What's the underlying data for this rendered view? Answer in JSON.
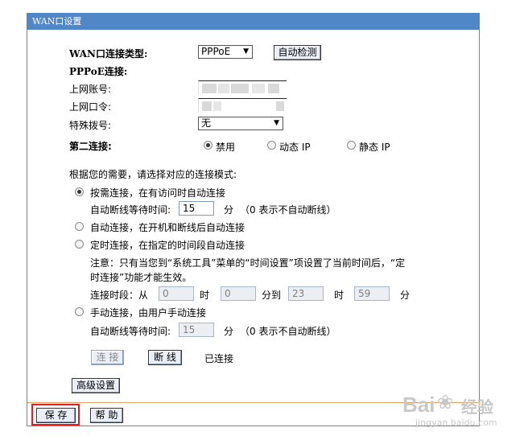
{
  "panel": {
    "title": "WAN口设置"
  },
  "wan_type": {
    "label": "WAN口连接类型:",
    "value": "PPPoE",
    "detect_button": "自动检测"
  },
  "pppoe": {
    "section_label": "PPPoE连接:",
    "username_label": "上网账号:",
    "password_label": "上网口令:",
    "dial_label": "特殊拨号:",
    "dial_value": "无"
  },
  "second_connection": {
    "label": "第二连接:",
    "options": [
      {
        "label": "禁用",
        "checked": true
      },
      {
        "label": "动态 IP",
        "checked": false
      },
      {
        "label": "静态 IP",
        "checked": false
      }
    ]
  },
  "mode": {
    "prompt": "根据您的需要，请选择对应的连接模式:",
    "on_demand": {
      "label": "按需连接，在有访问时自动连接",
      "checked": true
    },
    "idle1": {
      "label": "自动断线等待时间:",
      "value": "15",
      "unit": "分",
      "note": "（0 表示不自动断线）"
    },
    "auto": {
      "label": "自动连接，在开机和断线后自动连接",
      "checked": false
    },
    "timed": {
      "label": "定时连接，在指定的时间段自动连接",
      "checked": false
    },
    "timed_note_line1": "注意：只有当您到“系统工具”菜单的“时间设置”项设置了当前时间后，“定",
    "timed_note_line2": "时连接”功能才能生效。",
    "period": {
      "label": "连接时段：从",
      "from_hour": "0",
      "hour_unit": "时",
      "from_min": "0",
      "to_label": "分到",
      "to_hour": "23",
      "to_hour_unit": "时",
      "to_min": "59",
      "min_unit": "分"
    },
    "manual": {
      "label": "手动连接，由用户手动连接",
      "checked": false
    },
    "idle2": {
      "label": "自动断线等待时间:",
      "value": "15",
      "unit": "分",
      "note": "（0 表示不自动断线）"
    }
  },
  "actions": {
    "connect": "连 接",
    "disconnect": "断 线",
    "status": "已连接",
    "advanced": "高级设置"
  },
  "footer": {
    "save": "保 存",
    "help": "帮 助"
  },
  "watermark": {
    "brand": "Bai",
    "brand2": "经验",
    "url": "jingyan.baidu.com"
  }
}
